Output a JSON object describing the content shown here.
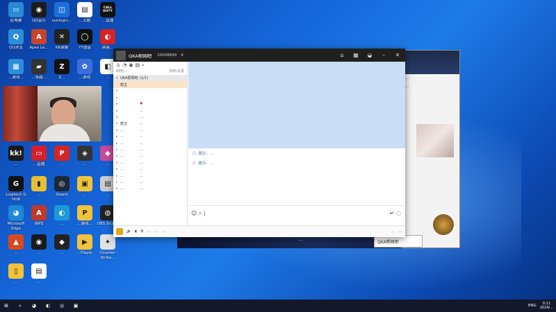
{
  "desktop": {
    "icons": [
      {
        "label": "此电脑",
        "color": "#2a8ad6",
        "glyph": "▭"
      },
      {
        "label": "QQ音乐",
        "color": "#1b1b1b",
        "glyph": "◉"
      },
      {
        "label": "sunlogin...",
        "color": "#1a6fd8",
        "glyph": "◫"
      },
      {
        "label": "...无题",
        "color": "#ffffff",
        "glyph": "▤"
      },
      {
        "label": "...直播",
        "color": "#111111",
        "glyph": "CALL DUTY"
      },
      {
        "label": "QQ浏览",
        "color": "#2d8ed8",
        "glyph": "Q"
      },
      {
        "label": "Apex Le...",
        "color": "#c7432b",
        "glyph": "A"
      },
      {
        "label": "KK录像",
        "color": "#222222",
        "glyph": "✕"
      },
      {
        "label": "YY语音",
        "color": "#111111",
        "glyph": "◯"
      },
      {
        "label": "网易...",
        "color": "#d42424",
        "glyph": "◐"
      },
      {
        "label": "...游戏...",
        "color": "#2b8edb",
        "glyph": "▦"
      },
      {
        "label": "...卓越...",
        "color": "#333333",
        "glyph": "▰"
      },
      {
        "label": "Z...",
        "color": "#111111",
        "glyph": "Z"
      },
      {
        "label": "...游戏",
        "color": "#3b6ed8",
        "glyph": "✿"
      },
      {
        "label": "...",
        "color": "#ffffff",
        "glyph": "◧"
      },
      {
        "label": "...",
        "color": "#1a1a1a",
        "glyph": "kk!"
      },
      {
        "label": "...直播",
        "color": "#d41f2c",
        "glyph": "▭"
      },
      {
        "label": "...",
        "color": "#d42424",
        "glyph": "P"
      },
      {
        "label": "...",
        "color": "#333333",
        "glyph": "◈"
      },
      {
        "label": "...",
        "color": "#c84a9a",
        "glyph": "◆"
      },
      {
        "label": "Logitech G HUB",
        "color": "#111111",
        "glyph": "G"
      },
      {
        "label": "...",
        "color": "#e6c030",
        "glyph": "▮"
      },
      {
        "label": "Steam",
        "color": "#1b2838",
        "glyph": "◎"
      },
      {
        "label": "...",
        "color": "#f2c23a",
        "glyph": "▣"
      },
      {
        "label": "...",
        "color": "#cccccc",
        "glyph": "▤"
      },
      {
        "label": "Microsoft Edge",
        "color": "#1e88d6",
        "glyph": "◕"
      },
      {
        "label": "WPS",
        "color": "#c0392b",
        "glyph": "A"
      },
      {
        "label": "...",
        "color": "#1d9ad6",
        "glyph": "◐"
      },
      {
        "label": "...游戏...",
        "color": "#f2c23a",
        "glyph": "P"
      },
      {
        "label": "OBS Studio",
        "color": "#222222",
        "glyph": "◍"
      },
      {
        "label": "...",
        "color": "#d9481e",
        "glyph": "▲"
      },
      {
        "label": "...",
        "color": "#1a1a1a",
        "glyph": "◉"
      },
      {
        "label": "...",
        "color": "#222222",
        "glyph": "◆"
      },
      {
        "label": "...Player",
        "color": "#f2c23a",
        "glyph": "▶"
      },
      {
        "label": "Counter-Strike...",
        "color": "#e0e0e0",
        "glyph": "✦"
      },
      {
        "label": "...",
        "color": "#f2c23a",
        "glyph": "▯"
      },
      {
        "label": "...",
        "color": "#ffffff",
        "glyph": "▤"
      }
    ]
  },
  "main_window": {
    "title": "QKA帮网吧",
    "id_text": "20008899",
    "count": "4",
    "sidebar": {
      "search_placeholder": "网吧/...",
      "search_hint": "排序/设置",
      "group_header": "QKA帮网吧",
      "group_count": "(1/1)",
      "highlight_label": "帮主",
      "rows": [
        {
          "a": "",
          "b": "",
          "c": ""
        },
        {
          "a": "",
          "b": "",
          "c": ""
        },
        {
          "a": "",
          "b": "♥",
          "c": ""
        },
        {
          "a": "",
          "b": "...",
          "c": ""
        },
        {
          "a": "",
          "b": "...",
          "c": ""
        },
        {
          "a": "帮主",
          "b": "...",
          "c": ""
        },
        {
          "a": "...",
          "b": "...",
          "c": ""
        },
        {
          "a": "...",
          "b": "...",
          "c": ""
        },
        {
          "a": "...",
          "b": "...",
          "c": ""
        },
        {
          "a": "...",
          "b": "...",
          "c": ""
        },
        {
          "a": "...",
          "b": "...",
          "c": ""
        },
        {
          "a": "...",
          "b": "...",
          "c": ""
        },
        {
          "a": "...",
          "b": "...",
          "c": ""
        },
        {
          "a": "...",
          "b": "...",
          "c": ""
        },
        {
          "a": "...",
          "b": "...",
          "c": ""
        },
        {
          "a": "...",
          "b": "...",
          "c": ""
        }
      ]
    },
    "messages": [
      "提示：...",
      "提示：..."
    ],
    "bottom": {
      "left_items": [
        "...",
        "...",
        "...",
        "...",
        "..."
      ],
      "right_items": [
        "...",
        "..."
      ]
    }
  },
  "back_window": {
    "text_lines": [
      "...",
      "...",
      "...",
      "..."
    ]
  },
  "gamebar_text": "...",
  "chat_window_title": "QKA帮网吧",
  "taskbar": {
    "tray_lang": "ENG",
    "time": "0:11",
    "date": "2024/..."
  }
}
